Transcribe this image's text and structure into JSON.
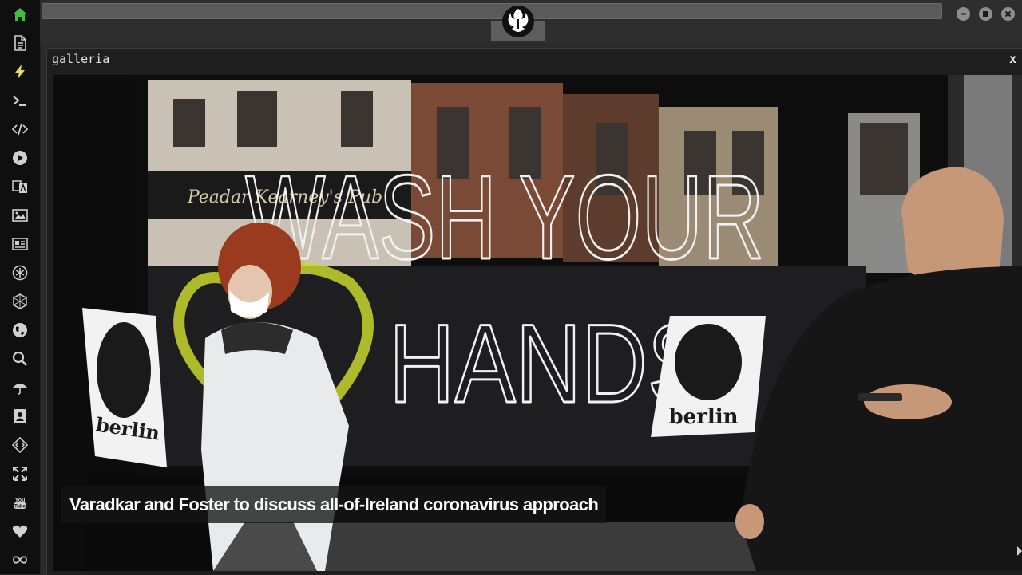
{
  "panel": {
    "title": "galleria",
    "close_label": "x"
  },
  "gallery": {
    "caption": "Varadkar and Foster to discuss all-of-Ireland coronavirus approach",
    "image_text": {
      "window_slogan": [
        "WASH YOUR",
        "HANDS"
      ],
      "poster_text": "berlin",
      "pub_sign": "Peadar Kearney's Pub"
    }
  },
  "sidebar": {
    "items": [
      {
        "icon": "home-icon",
        "active": true
      },
      {
        "icon": "document-icon"
      },
      {
        "icon": "lightning-icon"
      },
      {
        "icon": "terminal-icon"
      },
      {
        "icon": "code-icon"
      },
      {
        "icon": "play-icon"
      },
      {
        "icon": "translate-icon"
      },
      {
        "icon": "image-icon"
      },
      {
        "icon": "newspaper-icon"
      },
      {
        "icon": "asterisk-icon"
      },
      {
        "icon": "hexagon-icon"
      },
      {
        "icon": "globe-icon"
      },
      {
        "icon": "search-icon"
      },
      {
        "icon": "umbrella-icon"
      },
      {
        "icon": "contact-card-icon"
      },
      {
        "icon": "dev-icon"
      },
      {
        "icon": "expand-icon"
      },
      {
        "icon": "youtube-icon"
      },
      {
        "icon": "heart-icon"
      },
      {
        "icon": "infinity-icon"
      }
    ]
  },
  "window_controls": [
    "minimize-icon",
    "maximize-icon",
    "close-icon"
  ],
  "colors": {
    "sidebar_bg": "#0f0f0f",
    "active_icon": "#3fbf3f",
    "icon": "#d0d0d0",
    "panel_bg": "#1e1e1e"
  }
}
